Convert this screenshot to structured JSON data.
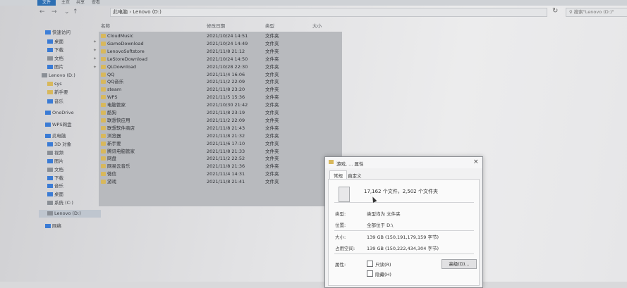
{
  "ribbon": {
    "tabs": [
      "文件",
      "主页",
      "共享",
      "查看"
    ]
  },
  "addressbar": {
    "back": "←",
    "forward": "→",
    "recent": "⌄",
    "up": "↑",
    "path": "此电脑 › Lenovo (D:)",
    "refresh": "↻",
    "search_placeholder": "搜索\"Lenovo (D:)\""
  },
  "sidebar": {
    "items": [
      {
        "label": "快速访问",
        "icon": "star-icon",
        "color": "#3d7fd8"
      },
      {
        "label": "桌面",
        "icon": "desktop-icon",
        "color": "#3a7bd5",
        "pinned": true
      },
      {
        "label": "下载",
        "icon": "download-icon",
        "color": "#3a7bd5",
        "pinned": true
      },
      {
        "label": "文档",
        "icon": "document-icon",
        "color": "#8a8f96",
        "pinned": true
      },
      {
        "label": "图片",
        "icon": "picture-icon",
        "color": "#3a7bd5",
        "pinned": true
      },
      {
        "label": "Lenovo (D:)",
        "icon": "drive-icon",
        "color": "#8a8f96"
      },
      {
        "label": "sys",
        "icon": "folder-icon",
        "color": "#d8b85c"
      },
      {
        "label": "新手要",
        "icon": "folder-icon",
        "color": "#d8b85c"
      },
      {
        "label": "音乐",
        "icon": "music-icon",
        "color": "#3a7bd5"
      },
      {
        "label": "OneDrive",
        "icon": "cloud-icon",
        "color": "#3a7bd5"
      },
      {
        "label": "WPS网盘",
        "icon": "cloud-icon",
        "color": "#3a7bd5"
      },
      {
        "label": "此电脑",
        "icon": "computer-icon",
        "color": "#3a7bd5"
      },
      {
        "label": "3D 对象",
        "icon": "cube-icon",
        "color": "#3a7bd5"
      },
      {
        "label": "视频",
        "icon": "video-icon",
        "color": "#8a8f96"
      },
      {
        "label": "图片",
        "icon": "picture-icon",
        "color": "#3a7bd5"
      },
      {
        "label": "文档",
        "icon": "document-icon",
        "color": "#8a8f96"
      },
      {
        "label": "下载",
        "icon": "download-icon",
        "color": "#3a7bd5"
      },
      {
        "label": "音乐",
        "icon": "music-icon",
        "color": "#3a7bd5"
      },
      {
        "label": "桌面",
        "icon": "desktop-icon",
        "color": "#3a7bd5"
      },
      {
        "label": "系统 (C:)",
        "icon": "drive-icon",
        "color": "#8a8f96"
      },
      {
        "label": "Lenovo (D:)",
        "icon": "drive-icon",
        "color": "#8a8f96",
        "selected": true
      },
      {
        "label": "网络",
        "icon": "network-icon",
        "color": "#3a7bd5"
      }
    ]
  },
  "filelist": {
    "headers": {
      "name": "名称",
      "date": "修改日期",
      "type": "类型",
      "size": "大小"
    },
    "rows": [
      {
        "name": "CloudMusic",
        "date": "2021/10/24 14:51",
        "type": "文件夹"
      },
      {
        "name": "GameDownload",
        "date": "2021/10/24 14:49",
        "type": "文件夹"
      },
      {
        "name": "LenovoSoftstore",
        "date": "2021/11/8 21:12",
        "type": "文件夹"
      },
      {
        "name": "LeStoreDownload",
        "date": "2021/10/24 14:50",
        "type": "文件夹"
      },
      {
        "name": "QLDownload",
        "date": "2021/10/28 22:30",
        "type": "文件夹"
      },
      {
        "name": "QQ",
        "date": "2021/11/4 16:06",
        "type": "文件夹"
      },
      {
        "name": "QQ音乐",
        "date": "2021/11/2 22:09",
        "type": "文件夹"
      },
      {
        "name": "steam",
        "date": "2021/11/8 23:20",
        "type": "文件夹"
      },
      {
        "name": "WPS",
        "date": "2021/11/5 15:36",
        "type": "文件夹"
      },
      {
        "name": "电脑管家",
        "date": "2021/10/30 21:42",
        "type": "文件夹"
      },
      {
        "name": "酷狗",
        "date": "2021/11/8 23:19",
        "type": "文件夹"
      },
      {
        "name": "联想快应用",
        "date": "2021/11/2 22:09",
        "type": "文件夹"
      },
      {
        "name": "联想软件商店",
        "date": "2021/11/8 21:43",
        "type": "文件夹"
      },
      {
        "name": "浏览器",
        "date": "2021/11/8 21:32",
        "type": "文件夹"
      },
      {
        "name": "新手要",
        "date": "2021/11/6 17:10",
        "type": "文件夹"
      },
      {
        "name": "腾讯电脑管家",
        "date": "2021/11/8 21:33",
        "type": "文件夹"
      },
      {
        "name": "网盘",
        "date": "2021/11/2 22:52",
        "type": "文件夹"
      },
      {
        "name": "网易云音乐",
        "date": "2021/11/8 21:36",
        "type": "文件夹"
      },
      {
        "name": "微信",
        "date": "2021/11/4 14:31",
        "type": "文件夹"
      },
      {
        "name": "游戏",
        "date": "2021/11/8 21:41",
        "type": "文件夹"
      }
    ]
  },
  "dialog": {
    "title": "游戏, ... 属性",
    "close": "×",
    "tabs": [
      "常规",
      "自定义"
    ],
    "summary": "17,162 个文件，2,502 个文件夹",
    "fields": [
      {
        "label": "类型:",
        "value": "类型均为 文件夹"
      },
      {
        "label": "位置:",
        "value": "全部位于 D:\\"
      },
      {
        "label": "大小:",
        "value": "139 GB (150,191,179,159 字节)"
      },
      {
        "label": "占用空间:",
        "value": "139 GB (150,222,434,304 字节)"
      }
    ],
    "attributes_label": "属性:",
    "readonly": "只读(R)",
    "hidden": "隐藏(H)",
    "advanced_button": "高级(D)..."
  }
}
